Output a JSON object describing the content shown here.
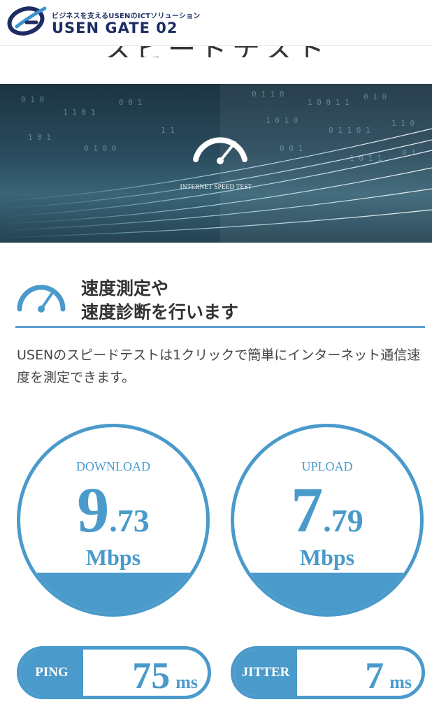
{
  "header": {
    "tagline": "ビジネスを支えるUSENのICTソリューション",
    "brand_name": "USEN GATE 02"
  },
  "page": {
    "title": "スピードテスト"
  },
  "hero": {
    "caption": "INTERNET SPEED TEST",
    "icon": "speedometer-icon"
  },
  "section": {
    "title_line1": "速度測定や",
    "title_line2": "速度診断を行います",
    "icon": "speedometer-icon",
    "lead": "USENのスピードテストは1クリックで簡単にインターネット通信速度を測定できます。"
  },
  "results": {
    "download": {
      "label": "DOWNLOAD",
      "int": "9",
      "dec": ".73",
      "unit": "Mbps"
    },
    "upload": {
      "label": "UPLOAD",
      "int": "7",
      "dec": ".79",
      "unit": "Mbps"
    },
    "ping": {
      "label": "PING",
      "value": "75",
      "unit": "ms"
    },
    "jitter": {
      "label": "JITTER",
      "value": "7",
      "unit": "ms"
    }
  },
  "colors": {
    "accent": "#4a9acb",
    "brand": "#1d2d63",
    "rule": "#5aa0cf"
  }
}
